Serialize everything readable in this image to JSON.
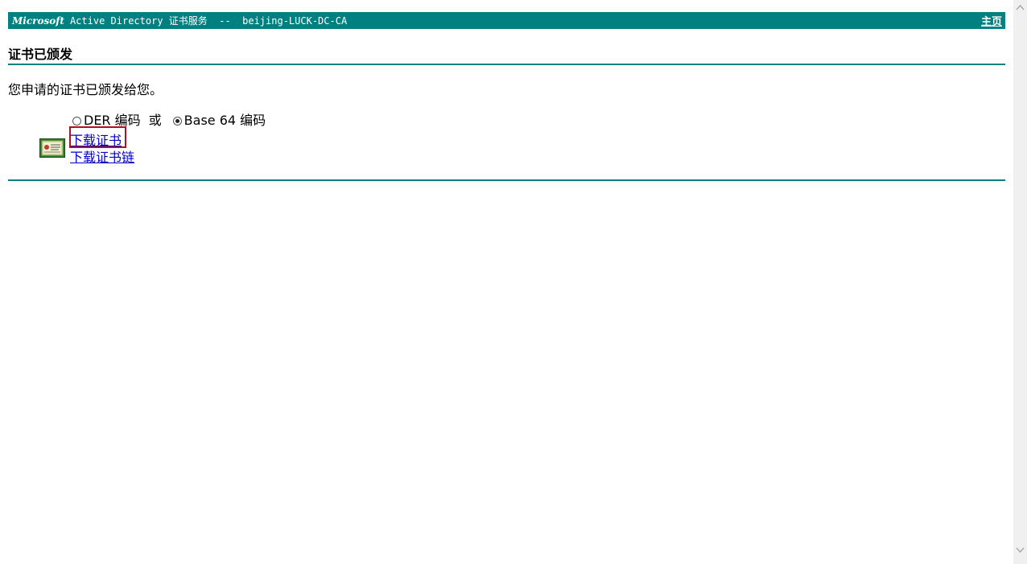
{
  "header": {
    "brand": "Microsoft",
    "service_title": "Active Directory 证书服务  --  beijing-LUCK-DC-CA",
    "home_link": "主页"
  },
  "main": {
    "section_title": "证书已颁发",
    "message": "您申请的证书已颁发给您。",
    "encoding": {
      "der_label": "DER 编码",
      "or_text": "或",
      "base64_label": "Base 64 编码",
      "selected": "Base 64 编码"
    },
    "links": {
      "download_cert": "下载证书",
      "download_chain": "下载证书链"
    }
  },
  "colors": {
    "header_bg": "#008080",
    "link": "#0000cc",
    "highlight": "#b01020"
  },
  "icons": {
    "certificate": "certificate-icon"
  }
}
